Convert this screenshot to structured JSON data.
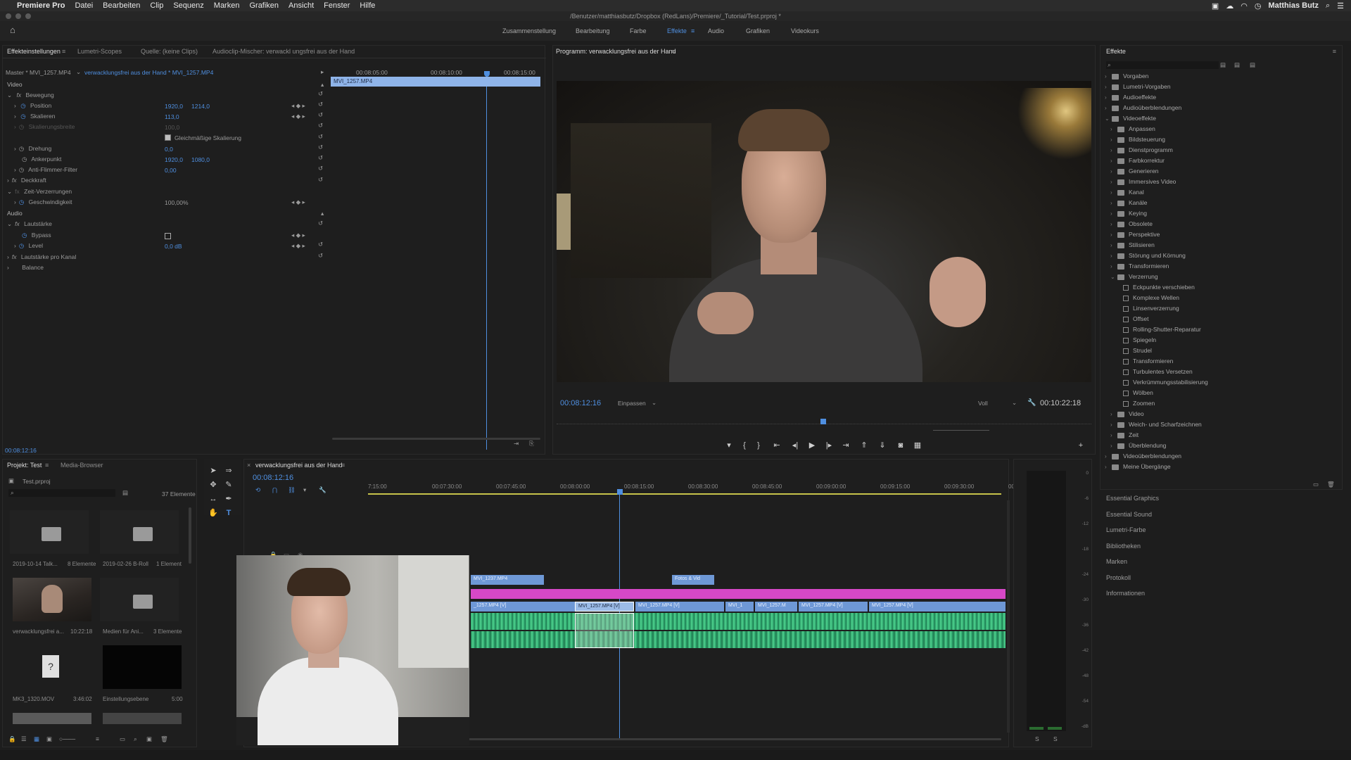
{
  "menubar": {
    "app": "Premiere Pro",
    "items": [
      "Datei",
      "Bearbeiten",
      "Clip",
      "Sequenz",
      "Marken",
      "Grafiken",
      "Ansicht",
      "Fenster",
      "Hilfe"
    ],
    "user": "Matthias Butz"
  },
  "titlebar": {
    "path": "/Benutzer/matthiasbutz/Dropbox (RedLans)/Premiere/_Tutorial/Test.prproj *"
  },
  "workspaces": [
    "Zusammenstellung",
    "Bearbeitung",
    "Farbe",
    "Effekte",
    "Audio",
    "Grafiken",
    "Videokurs"
  ],
  "effect_controls": {
    "tabs": [
      "Effekteinstellungen",
      "Lumetri-Scopes",
      "Quelle: (keine Clips)",
      "Audioclip-Mischer: verwackl ungsfrei aus der Hand"
    ],
    "master": "Master * MVI_1257.MP4",
    "sequence_clip": "verwacklungsfrei aus der Hand * MVI_1257.MP4",
    "ruler": [
      "00:08:05:00",
      "00:08:10:00",
      "00:08:15:00"
    ],
    "clip_label": "MVI_1257.MP4",
    "section_video": "Video",
    "bewegung": "Bewegung",
    "position_label": "Position",
    "position_x": "1920,0",
    "position_y": "1214,0",
    "skalieren_label": "Skalieren",
    "skalieren_val": "113,0",
    "skalierungsbreite_label": "Skalierungsbreite",
    "skalierungsbreite_val": "100,0",
    "gleichmaessig": "Gleichmäßige Skalierung",
    "drehung_label": "Drehung",
    "drehung_val": "0,0",
    "ankerpunkt_label": "Ankerpunkt",
    "ankerpunkt_x": "1920,0",
    "ankerpunkt_y": "1080,0",
    "antiflimmer_label": "Anti-Flimmer-Filter",
    "antiflimmer_val": "0,00",
    "deckkraft": "Deckkraft",
    "zeitverzerrung": "Zeit-Verzerrungen",
    "geschwindigkeit_label": "Geschwindigkeit",
    "geschwindigkeit_val": "100,00%",
    "section_audio": "Audio",
    "lautstaerke": "Lautstärke",
    "bypass_label": "Bypass",
    "level_label": "Level",
    "level_val": "0,0 dB",
    "lautstaerke_kanal": "Lautstärke pro Kanal",
    "balance": "Balance",
    "timecode": "00:08:12:16"
  },
  "program": {
    "title": "Programm: verwacklungsfrei aus der Hand",
    "timecode": "00:08:12:16",
    "fit": "Einpassen",
    "quality": "Voll",
    "duration": "00:10:22:18"
  },
  "effects": {
    "title": "Effekte",
    "tree": [
      {
        "label": "Vorgaben",
        "level": 0
      },
      {
        "label": "Lumetri-Vorgaben",
        "level": 0
      },
      {
        "label": "Audioeffekte",
        "level": 0
      },
      {
        "label": "Audioüberblendungen",
        "level": 0
      },
      {
        "label": "Videoeffekte",
        "level": 0
      },
      {
        "label": "Anpassen",
        "level": 1
      },
      {
        "label": "Bildsteuerung",
        "level": 1
      },
      {
        "label": "Dienstprogramm",
        "level": 1
      },
      {
        "label": "Farbkorrektur",
        "level": 1
      },
      {
        "label": "Generieren",
        "level": 1
      },
      {
        "label": "Immersives Video",
        "level": 1
      },
      {
        "label": "Kanal",
        "level": 1
      },
      {
        "label": "Kanäle",
        "level": 1
      },
      {
        "label": "Keying",
        "level": 1
      },
      {
        "label": "Obsolete",
        "level": 1
      },
      {
        "label": "Perspektive",
        "level": 1
      },
      {
        "label": "Stilisieren",
        "level": 1
      },
      {
        "label": "Störung und Körnung",
        "level": 1
      },
      {
        "label": "Transformieren",
        "level": 1
      },
      {
        "label": "Verzerrung",
        "level": 1
      },
      {
        "label": "Eckpunkte verschieben",
        "level": 2
      },
      {
        "label": "Komplexe Wellen",
        "level": 2
      },
      {
        "label": "Linsenverzerrung",
        "level": 2
      },
      {
        "label": "Offset",
        "level": 2
      },
      {
        "label": "Rolling-Shutter-Reparatur",
        "level": 2
      },
      {
        "label": "Spiegeln",
        "level": 2
      },
      {
        "label": "Strudel",
        "level": 2
      },
      {
        "label": "Transformieren",
        "level": 2
      },
      {
        "label": "Turbulentes Versetzen",
        "level": 2
      },
      {
        "label": "Verkrümmungsstabilisierung",
        "level": 2
      },
      {
        "label": "Wölben",
        "level": 2
      },
      {
        "label": "Zoomen",
        "level": 2
      },
      {
        "label": "Video",
        "level": 1
      },
      {
        "label": "Weich- und Scharfzeichnen",
        "level": 1
      },
      {
        "label": "Zeit",
        "level": 1
      },
      {
        "label": "Überblendung",
        "level": 1
      },
      {
        "label": "Videoüberblendungen",
        "level": 0
      },
      {
        "label": "Meine Übergänge",
        "level": 0
      }
    ],
    "side_panels": [
      "Essential Graphics",
      "Essential Sound",
      "Lumetri-Farbe",
      "Bibliotheken",
      "Marken",
      "Protokoll",
      "Informationen"
    ]
  },
  "project": {
    "tabs": [
      "Projekt: Test",
      "Media-Browser"
    ],
    "file": "Test.prproj",
    "count": "37 Elemente",
    "items": [
      {
        "name": "2019-10-14 Talk...",
        "info": "8 Elemente"
      },
      {
        "name": "2019-02-26 B-Roll",
        "info": "1 Element"
      },
      {
        "name": "verwacklungsfrei a...",
        "info": "10:22:18"
      },
      {
        "name": "Medien für Ani...",
        "info": "3 Elemente"
      },
      {
        "name": "MK3_1320.MOV",
        "info": "3:46:02"
      },
      {
        "name": "Einstellungsebene",
        "info": "5:00"
      }
    ]
  },
  "timeline": {
    "tab": "verwacklungsfrei aus der Hand",
    "timecode": "00:08:12:16",
    "ruler": [
      "7:15:00",
      "00:07:30:00",
      "00:07:45:00",
      "00:08:00:00",
      "00:08:15:00",
      "00:08:30:00",
      "00:08:45:00",
      "00:09:00:00",
      "00:09:15:00",
      "00:09:30:00",
      "00"
    ],
    "clips_v3": [
      "MVI_1237.MP4",
      "Fotos & Vid"
    ],
    "clips_v1": [
      "_1257.MP4 [V]",
      "MVI_1257.MP4 [V]",
      "MVI_1257.MP4 [V]",
      "MVI_1",
      "MVI_1257.M",
      "MVI_1257.MP4 [V]",
      "MVI_1257.MP4 [V]"
    ]
  },
  "meter": {
    "ticks": [
      "0",
      "-6",
      "-12",
      "-18",
      "-24",
      "-30",
      "-36",
      "-42",
      "-48",
      "-54",
      "-dB"
    ],
    "lr": [
      "S",
      "S"
    ]
  }
}
